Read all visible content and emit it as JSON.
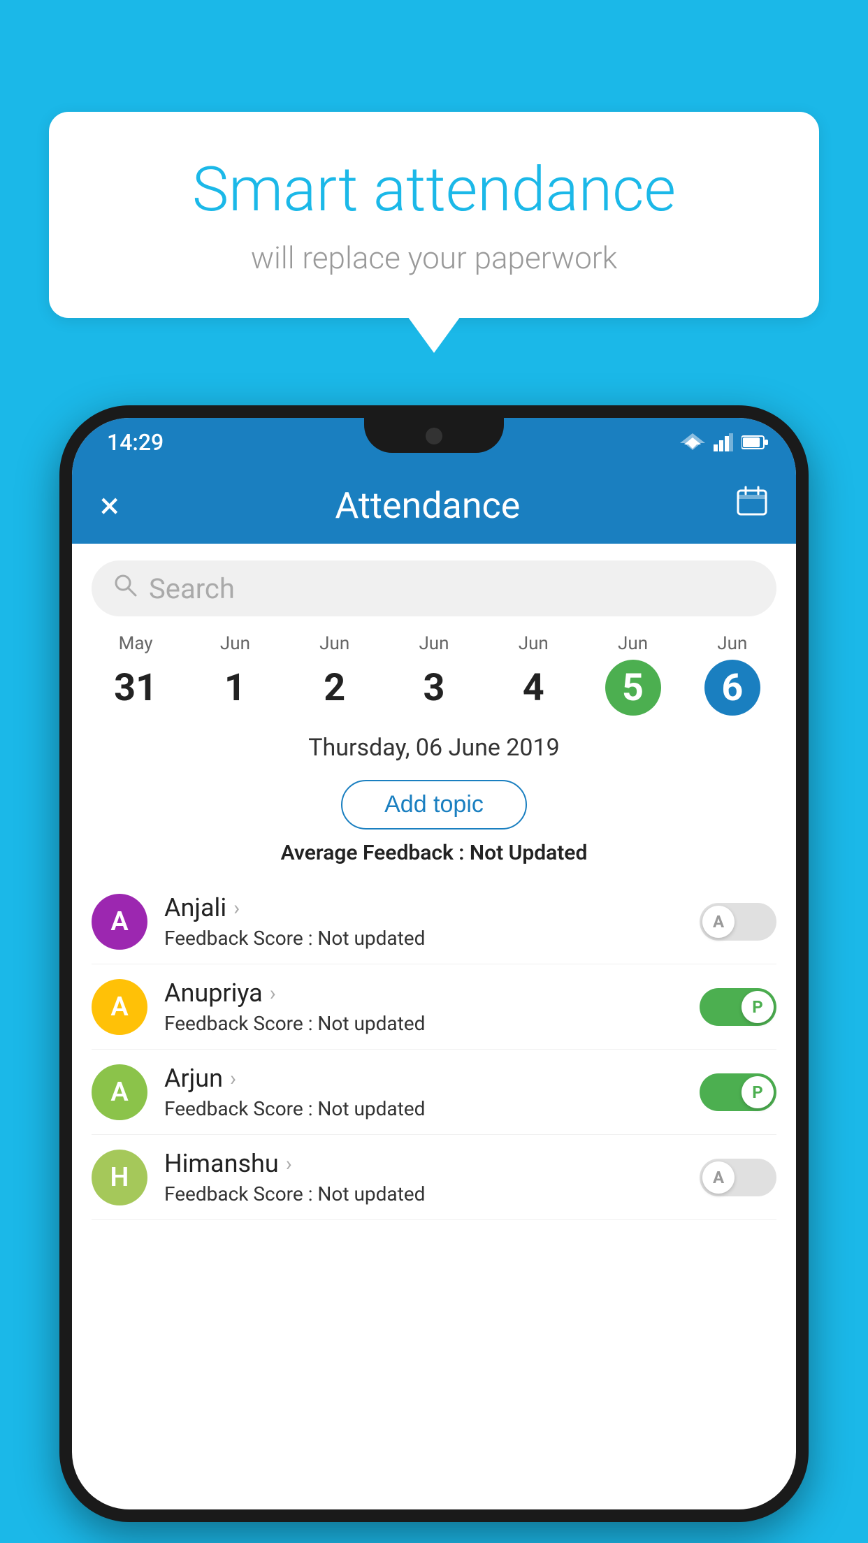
{
  "background_color": "#1bb8e8",
  "speech_bubble": {
    "title": "Smart attendance",
    "subtitle": "will replace your paperwork"
  },
  "status_bar": {
    "time": "14:29"
  },
  "app_bar": {
    "title": "Attendance",
    "close_label": "×",
    "calendar_icon": "📅"
  },
  "search": {
    "placeholder": "Search"
  },
  "calendar": {
    "days": [
      {
        "month": "May",
        "day": "31",
        "state": "normal"
      },
      {
        "month": "Jun",
        "day": "1",
        "state": "normal"
      },
      {
        "month": "Jun",
        "day": "2",
        "state": "normal"
      },
      {
        "month": "Jun",
        "day": "3",
        "state": "normal"
      },
      {
        "month": "Jun",
        "day": "4",
        "state": "normal"
      },
      {
        "month": "Jun",
        "day": "5",
        "state": "today"
      },
      {
        "month": "Jun",
        "day": "6",
        "state": "selected"
      }
    ]
  },
  "selected_date": "Thursday, 06 June 2019",
  "add_topic_label": "Add topic",
  "avg_feedback_label": "Average Feedback : ",
  "avg_feedback_value": "Not Updated",
  "students": [
    {
      "name": "Anjali",
      "initial": "A",
      "avatar_color": "#9c27b0",
      "feedback_label": "Feedback Score : ",
      "feedback_value": "Not updated",
      "attendance": "absent"
    },
    {
      "name": "Anupriya",
      "initial": "A",
      "avatar_color": "#ffc107",
      "feedback_label": "Feedback Score : ",
      "feedback_value": "Not updated",
      "attendance": "present"
    },
    {
      "name": "Arjun",
      "initial": "A",
      "avatar_color": "#8bc34a",
      "feedback_label": "Feedback Score : ",
      "feedback_value": "Not updated",
      "attendance": "present"
    },
    {
      "name": "Himanshu",
      "initial": "H",
      "avatar_color": "#a5c85a",
      "feedback_label": "Feedback Score : ",
      "feedback_value": "Not updated",
      "attendance": "absent"
    }
  ],
  "toggle_absent_label": "A",
  "toggle_present_label": "P"
}
